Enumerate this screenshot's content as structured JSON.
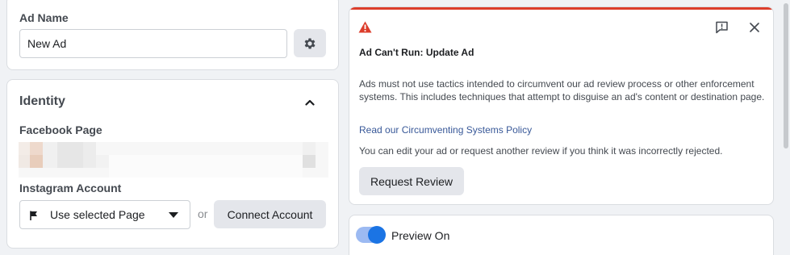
{
  "ad_name": {
    "label": "Ad Name",
    "value": "New Ad",
    "settings_icon": "gear-icon"
  },
  "identity": {
    "title": "Identity",
    "collapse_icon": "chevron-up-icon",
    "facebook_page_label": "Facebook Page",
    "instagram_label": "Instagram Account",
    "instagram_select_value": "Use selected Page",
    "or_text": "or",
    "connect_button": "Connect Account"
  },
  "alert": {
    "icon": "warning-icon",
    "accent_color": "#dc3d2b",
    "title": "Ad Can't Run: Update Ad",
    "body": "Ads must not use tactics intended to circumvent our ad review process or other enforcement systems. This includes techniques that attempt to disguise an ad's content or destination page.",
    "link": "Read our Circumventing Systems Policy",
    "note": "You can edit your ad or request another review if you think it was incorrectly rejected.",
    "request_button": "Request Review",
    "feedback_icon": "feedback-icon",
    "close_icon": "close-icon"
  },
  "preview": {
    "label": "Preview On",
    "toggle_on": true
  }
}
